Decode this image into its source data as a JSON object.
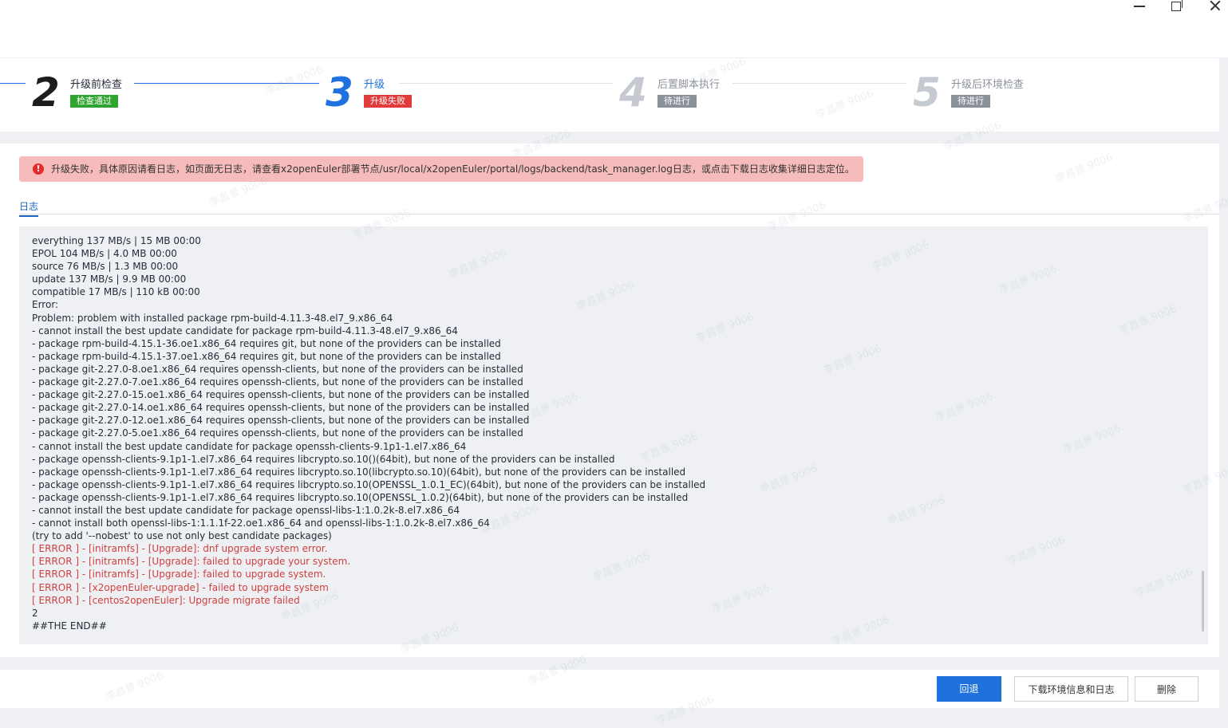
{
  "window": {
    "controls": [
      "minimize",
      "maximize",
      "close"
    ]
  },
  "steps": [
    {
      "number": "2",
      "title": "升级前检查",
      "badge": "检查通过",
      "color": "#1d1d1d",
      "badge_color": "#2fa52f"
    },
    {
      "number": "3",
      "title": "升级",
      "badge": "升级失败",
      "color": "#1f71dd",
      "badge_color": "#e13b3b"
    },
    {
      "number": "4",
      "title": "后置脚本执行",
      "badge": "待进行",
      "color": "#c5c9d0",
      "badge_color": "#8b919b"
    },
    {
      "number": "5",
      "title": "升级后环境检查",
      "badge": "待进行",
      "color": "#c5c9d0",
      "badge_color": "#8b919b"
    }
  ],
  "alert": {
    "icon": "error-icon",
    "text": "升级失败，具体原因请看日志，如页面无日志，请查看x2openEuler部署节点/usr/local/x2openEuler/portal/logs/backend/task_manager.log日志，或点击下载日志收集详细日志定位。"
  },
  "tab": {
    "label": "日志"
  },
  "log": {
    "lines": [
      {
        "text": "everything 137 MB/s | 15 MB 00:00",
        "error": false
      },
      {
        "text": "EPOL 104 MB/s | 4.0 MB 00:00",
        "error": false
      },
      {
        "text": "source 76 MB/s | 1.3 MB 00:00",
        "error": false
      },
      {
        "text": "update 137 MB/s | 9.9 MB 00:00",
        "error": false
      },
      {
        "text": "compatible 17 MB/s | 110 kB 00:00",
        "error": false
      },
      {
        "text": "Error:",
        "error": false
      },
      {
        "text": "Problem: problem with installed package rpm-build-4.11.3-48.el7_9.x86_64",
        "error": false
      },
      {
        "text": "- cannot install the best update candidate for package rpm-build-4.11.3-48.el7_9.x86_64",
        "error": false
      },
      {
        "text": "- package rpm-build-4.15.1-36.oe1.x86_64 requires git, but none of the providers can be installed",
        "error": false
      },
      {
        "text": "- package rpm-build-4.15.1-37.oe1.x86_64 requires git, but none of the providers can be installed",
        "error": false
      },
      {
        "text": "- package git-2.27.0-8.oe1.x86_64 requires openssh-clients, but none of the providers can be installed",
        "error": false
      },
      {
        "text": "- package git-2.27.0-7.oe1.x86_64 requires openssh-clients, but none of the providers can be installed",
        "error": false
      },
      {
        "text": "- package git-2.27.0-15.oe1.x86_64 requires openssh-clients, but none of the providers can be installed",
        "error": false
      },
      {
        "text": "- package git-2.27.0-14.oe1.x86_64 requires openssh-clients, but none of the providers can be installed",
        "error": false
      },
      {
        "text": "- package git-2.27.0-12.oe1.x86_64 requires openssh-clients, but none of the providers can be installed",
        "error": false
      },
      {
        "text": "- package git-2.27.0-5.oe1.x86_64 requires openssh-clients, but none of the providers can be installed",
        "error": false
      },
      {
        "text": "- cannot install the best update candidate for package openssh-clients-9.1p1-1.el7.x86_64",
        "error": false
      },
      {
        "text": "- package openssh-clients-9.1p1-1.el7.x86_64 requires libcrypto.so.10()(64bit), but none of the providers can be installed",
        "error": false
      },
      {
        "text": "- package openssh-clients-9.1p1-1.el7.x86_64 requires libcrypto.so.10(libcrypto.so.10)(64bit), but none of the providers can be installed",
        "error": false
      },
      {
        "text": "- package openssh-clients-9.1p1-1.el7.x86_64 requires libcrypto.so.10(OPENSSL_1.0.1_EC)(64bit), but none of the providers can be installed",
        "error": false
      },
      {
        "text": "- package openssh-clients-9.1p1-1.el7.x86_64 requires libcrypto.so.10(OPENSSL_1.0.2)(64bit), but none of the providers can be installed",
        "error": false
      },
      {
        "text": "- cannot install the best update candidate for package openssl-libs-1:1.0.2k-8.el7.x86_64",
        "error": false
      },
      {
        "text": "- cannot install both openssl-libs-1:1.1.1f-22.oe1.x86_64 and openssl-libs-1:1.0.2k-8.el7.x86_64",
        "error": false
      },
      {
        "text": "(try to add '--nobest' to use not only best candidate packages)",
        "error": false
      },
      {
        "text": "[ ERROR ] - [initramfs] - [Upgrade]: dnf upgrade system error.",
        "error": true
      },
      {
        "text": "[ ERROR ] - [initramfs] - [Upgrade]: failed to upgrade your system.",
        "error": true
      },
      {
        "text": "[ ERROR ] - [initramfs] - [Upgrade]: failed to upgrade system.",
        "error": true
      },
      {
        "text": "[ ERROR ] - [x2openEuler-upgrade] - failed to upgrade system",
        "error": true
      },
      {
        "text": "[ ERROR ] - [centos2openEuler]: Upgrade migrate failed",
        "error": true
      },
      {
        "text": "2",
        "error": false
      },
      {
        "text": "##THE END##",
        "error": false
      }
    ]
  },
  "footer": {
    "rollback": "回退",
    "download": "下载环境信息和日志",
    "delete": "删除"
  },
  "watermark": "李昌景 9006",
  "colors": {
    "primary": "#1f71dd",
    "error_text": "#d03f3f",
    "alert_bg": "#f6bcbc"
  }
}
